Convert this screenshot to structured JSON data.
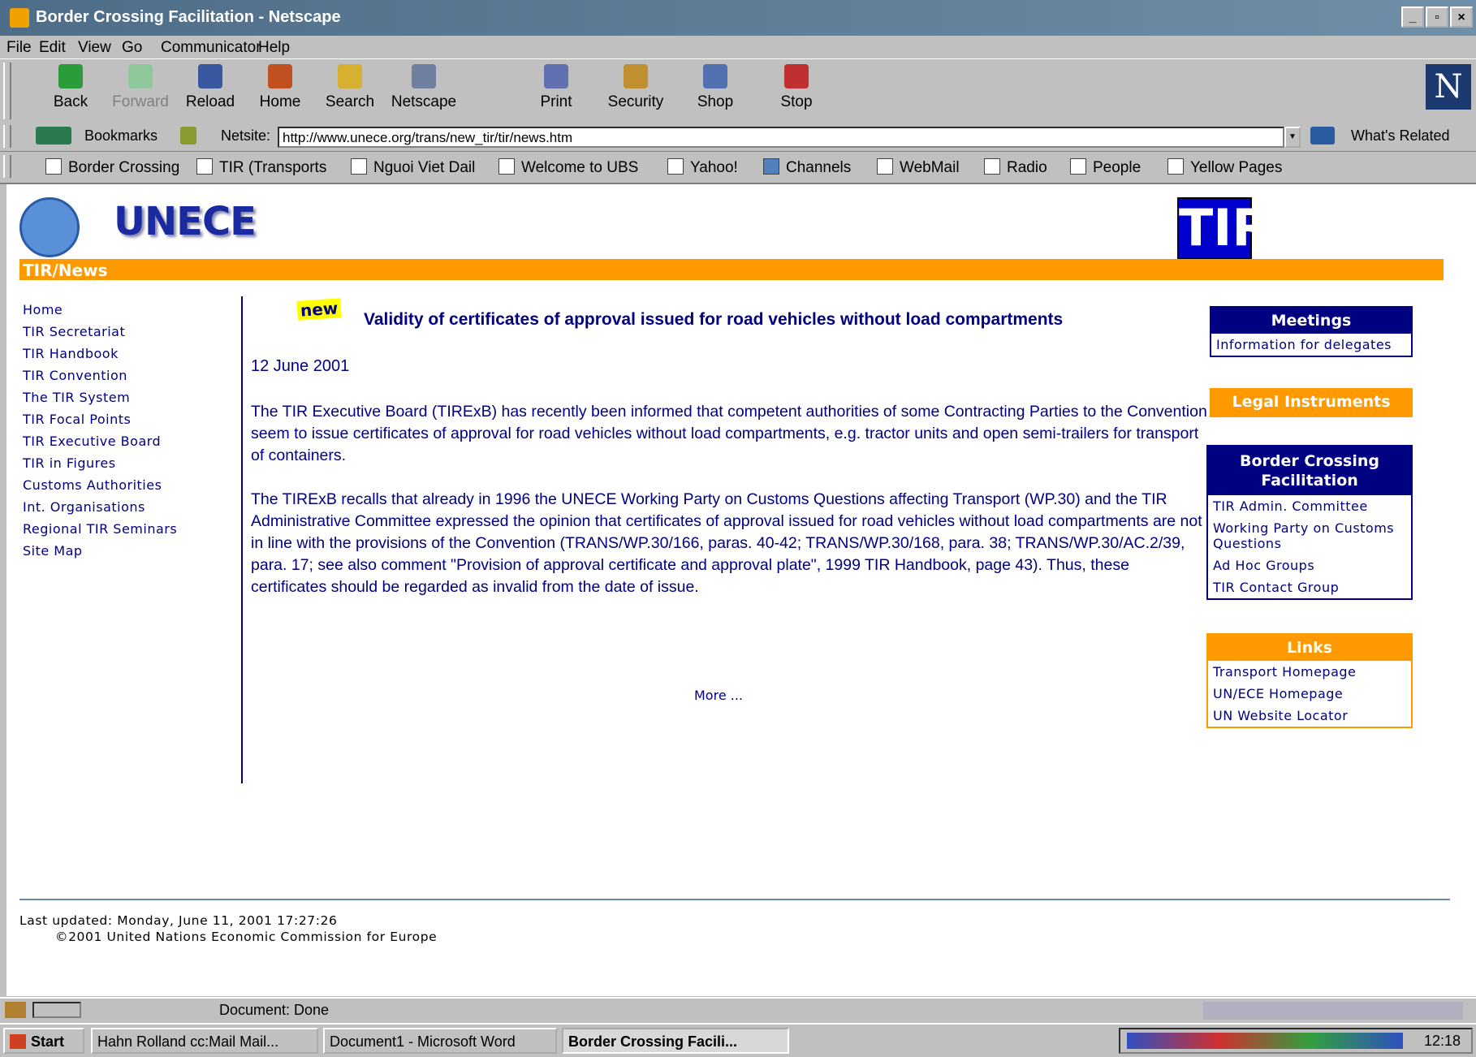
{
  "window": {
    "title": "Border Crossing Facilitation - Netscape"
  },
  "menu": [
    "File",
    "Edit",
    "View",
    "Go",
    "Communicator",
    "Help"
  ],
  "toolbar": [
    "Back",
    "Forward",
    "Reload",
    "Home",
    "Search",
    "Netscape",
    "Print",
    "Security",
    "Shop",
    "Stop"
  ],
  "location": {
    "bookmarks_label": "Bookmarks",
    "netsite_label": "Netsite:",
    "url": "http://www.unece.org/trans/new_tir/tir/news.htm",
    "whats_related": "What's Related"
  },
  "personal_toolbar": [
    "Border Crossing",
    "TIR (Transports",
    "Nguoi Viet Dail",
    "Welcome to UBS",
    "Yahoo!",
    "Channels",
    "WebMail",
    "Radio",
    "People",
    "Yellow Pages"
  ],
  "page": {
    "logo_text": "UNECE",
    "tir_logo": "TIR",
    "section_bar": "TIR/News",
    "sidebar": [
      "Home",
      "TIR Secretariat",
      "TIR Handbook",
      "TIR Convention",
      "The TIR System",
      "TIR Focal Points",
      "TIR Executive Board",
      "TIR in Figures",
      "Customs Authorities",
      "Int. Organisations",
      "Regional TIR Seminars",
      "Site Map"
    ],
    "new_badge": "new",
    "headline": "Validity of certificates of approval issued for road vehicles without load compartments",
    "date": "12 June 2001",
    "paragraph1": "The TIR Executive Board (TIRExB) has recently been informed that competent authorities of some Contracting Parties to the Convention seem to issue certificates of approval for road vehicles without load compartments, e.g. tractor units and open semi-trailers for transport of containers.",
    "paragraph2": "The TIRExB recalls that already in 1996 the UNECE Working Party on Customs Questions affecting Transport (WP.30) and the TIR Administrative Committee expressed the opinion that certificates of approval issued for road vehicles without load compartments are not in line with the provisions of the Convention (TRANS/WP.30/166, paras. 40-42; TRANS/WP.30/168, para. 38; TRANS/WP.30/AC.2/39, para. 17; see also comment \"Provision of approval certificate and approval plate\", 1999 TIR Handbook, page 43). Thus, these certificates should be regarded as invalid from the date of issue.",
    "more": "More ...",
    "meetings": {
      "title": "Meetings",
      "links": [
        "Information for delegates"
      ]
    },
    "legal": {
      "title": "Legal Instruments"
    },
    "border": {
      "title": "Border Crossing Facilitation",
      "links": [
        "TIR Admin. Committee",
        "Working Party on Customs Questions",
        "Ad Hoc Groups",
        "TIR Contact Group"
      ]
    },
    "links": {
      "title": "Links",
      "links": [
        "Transport Homepage",
        "UN/ECE Homepage",
        "UN Website Locator"
      ]
    },
    "footer_updated": "Last updated: Monday, June 11, 2001 17:27:26",
    "footer_copyright": "©2001 United Nations Economic Commission for Europe"
  },
  "status": {
    "text": "Document: Done"
  },
  "taskbar": {
    "start": "Start",
    "tasks": [
      "Hahn Rolland cc:Mail Mail...",
      "Document1 - Microsoft Word",
      "Border Crossing Facili..."
    ],
    "clock": "12:18"
  }
}
